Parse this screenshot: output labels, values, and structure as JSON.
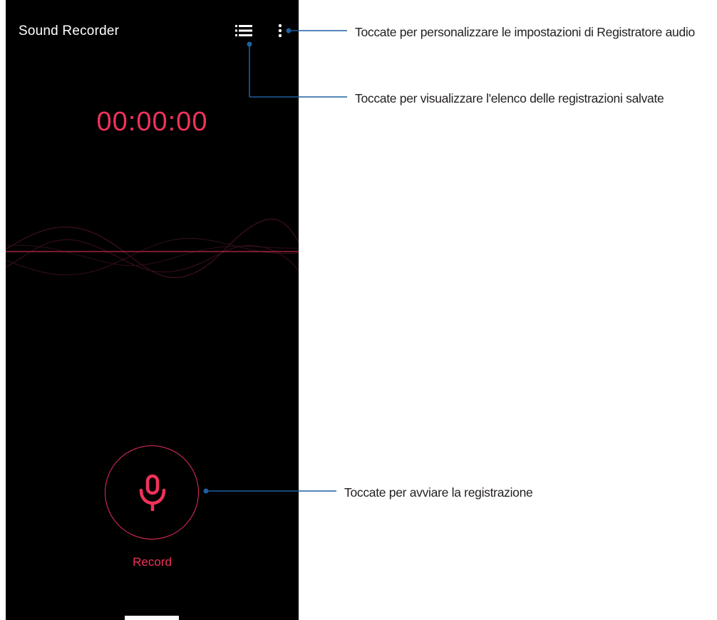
{
  "app": {
    "title": "Sound Recorder"
  },
  "toolbar": {
    "list_icon": "list-icon",
    "more_icon": "more-vert-icon"
  },
  "timer": {
    "value": "00:00:00"
  },
  "record": {
    "icon": "microphone-icon",
    "label": "Record"
  },
  "annotations": {
    "settings": "Toccate per personalizzare le impostazioni di Registratore audio",
    "list": "Toccate per visualizzare l'elenco delle registrazioni salvate",
    "record": "Toccate per avviare la registrazione"
  },
  "colors": {
    "accent": "#f0325a",
    "callout": "#1f5fa0",
    "background": "#000000"
  }
}
